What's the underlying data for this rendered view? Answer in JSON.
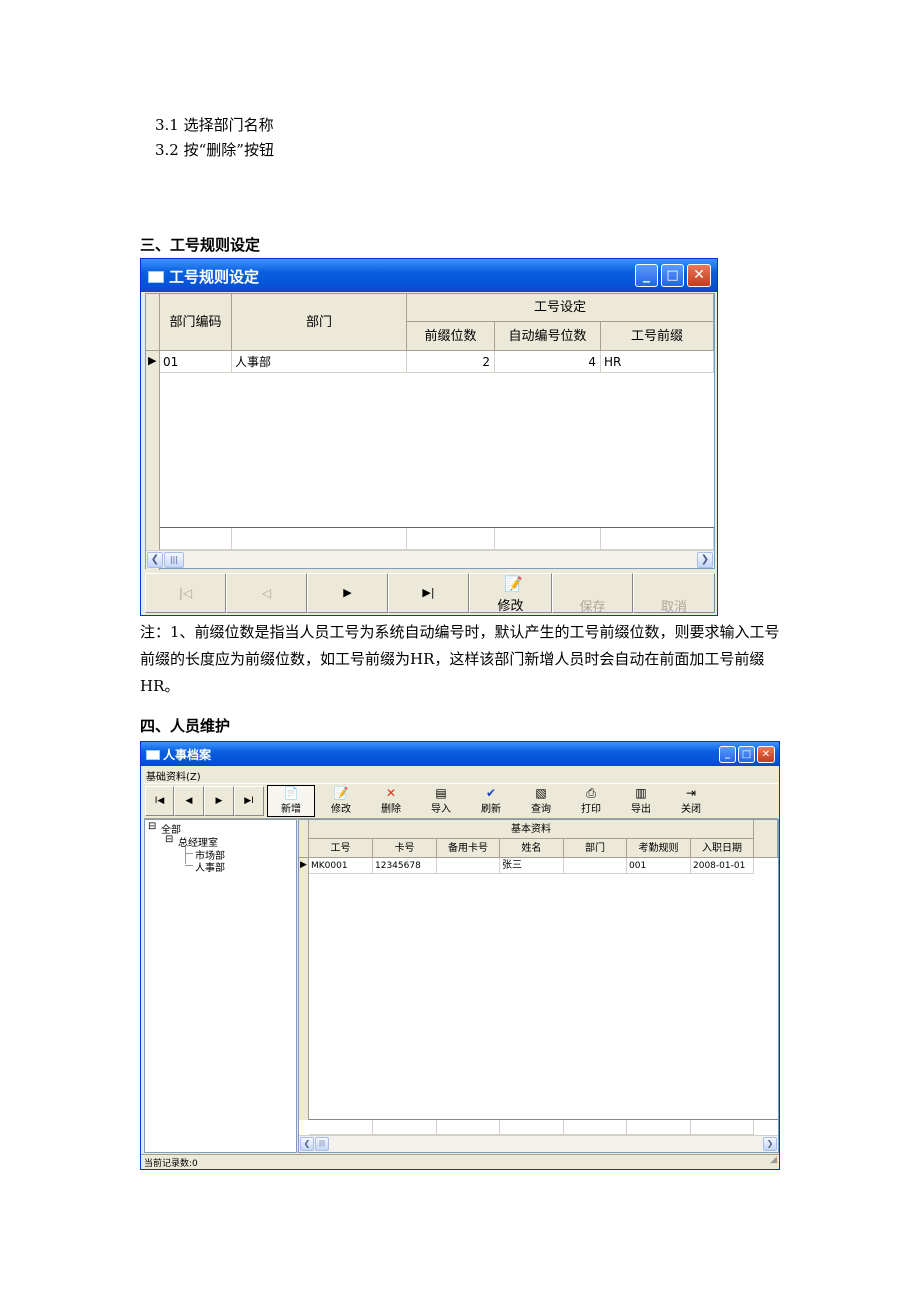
{
  "doc": {
    "step_3_1": "3.1  选择部门名称",
    "step_3_2": "3.2  按“删除”按钮",
    "section3_title": "三、工号规则设定",
    "note": "注：1、前缀位数是指当人员工号为系统自动编号时，默认产生的工号前缀位数，则要求输入工号前缀的长度应为前缀位数，如工号前缀为HR，这样该部门新增人员时会自动在前面加工号前缀HR。",
    "section4_title": "四、人员维护"
  },
  "win1": {
    "title": "工号规则设定",
    "headers": {
      "dept_code": "部门编码",
      "dept": "部门",
      "group": "工号设定",
      "prefix_digits": "前缀位数",
      "auto_digits": "自动编号位数",
      "prefix": "工号前缀"
    },
    "rows": [
      {
        "dept_code": "01",
        "dept": "人事部",
        "prefix_digits": "2",
        "auto_digits": "4",
        "prefix": "HR"
      }
    ],
    "nav": {
      "first": "|◁",
      "prev": "◁",
      "next": "▶",
      "last": "▶|",
      "edit": "修改",
      "save": "保存",
      "cancel": "取消"
    }
  },
  "win2": {
    "title": "人事档案",
    "menu": "基础资料(Z)",
    "nav": {
      "first": "I◀",
      "prev": "◀",
      "next": "▶",
      "last": "▶I"
    },
    "toolbar": {
      "new": "新增",
      "edit": "修改",
      "delete": "删除",
      "import": "导入",
      "refresh": "刷新",
      "query": "查询",
      "print": "打印",
      "export": "导出",
      "close": "关闭"
    },
    "tree": {
      "root": "全部",
      "child": "总经理室",
      "leaf1": "市场部",
      "leaf2": "人事部"
    },
    "headers": {
      "group": "基本资料",
      "emp_no": "工号",
      "card_no": "卡号",
      "backup_card": "备用卡号",
      "name": "姓名",
      "dept": "部门",
      "rule": "考勤规则",
      "hire_date": "入职日期"
    },
    "rows": [
      {
        "emp_no": "MK0001",
        "card_no": "12345678",
        "backup_card": "",
        "name": "张三",
        "dept": "",
        "rule": "001",
        "hire_date": "2008-01-01"
      }
    ],
    "status": "当前记录数:0"
  }
}
